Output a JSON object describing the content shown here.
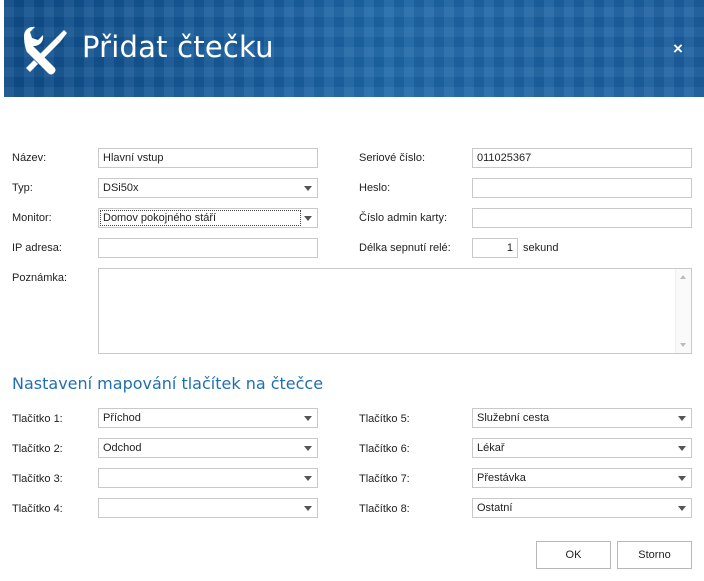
{
  "dialog": {
    "title": "Přidat čtečku",
    "close_label": "×"
  },
  "form": {
    "nazev": {
      "label": "Název:",
      "value": "Hlavní vstup"
    },
    "typ": {
      "label": "Typ:",
      "value": "DSi50x"
    },
    "monitor": {
      "label": "Monitor:",
      "value": "Domov pokojného stáří"
    },
    "ip": {
      "label": "IP adresa:",
      "value": ""
    },
    "poznamka": {
      "label": "Poznámka:",
      "value": ""
    },
    "seriove": {
      "label": "Seriové číslo:",
      "value": "011025367"
    },
    "heslo": {
      "label": "Heslo:",
      "value": ""
    },
    "admin_karta": {
      "label": "Číslo admin karty:",
      "value": ""
    },
    "rele": {
      "label": "Délka sepnutí relé:",
      "value": "1",
      "unit": "sekund"
    }
  },
  "mapping": {
    "title": "Nastavení mapování tlačítek na čtečce",
    "buttons": [
      {
        "label": "Tlačítko 1:",
        "value": "Příchod"
      },
      {
        "label": "Tlačítko 2:",
        "value": "Odchod"
      },
      {
        "label": "Tlačítko 3:",
        "value": ""
      },
      {
        "label": "Tlačítko 4:",
        "value": ""
      },
      {
        "label": "Tlačítko 5:",
        "value": "Služební cesta"
      },
      {
        "label": "Tlačítko 6:",
        "value": "Lékař"
      },
      {
        "label": "Tlačítko 7:",
        "value": "Přestávka"
      },
      {
        "label": "Tlačítko 8:",
        "value": "Ostatní"
      }
    ]
  },
  "actions": {
    "ok_label": "OK",
    "cancel_label": "Storno"
  },
  "colors": {
    "header_bg": "#1a5f9e",
    "accent": "#1f6fb3"
  },
  "icons": {
    "header": "tools-icon",
    "close": "close-icon",
    "dropdown": "chevron-down-icon"
  }
}
